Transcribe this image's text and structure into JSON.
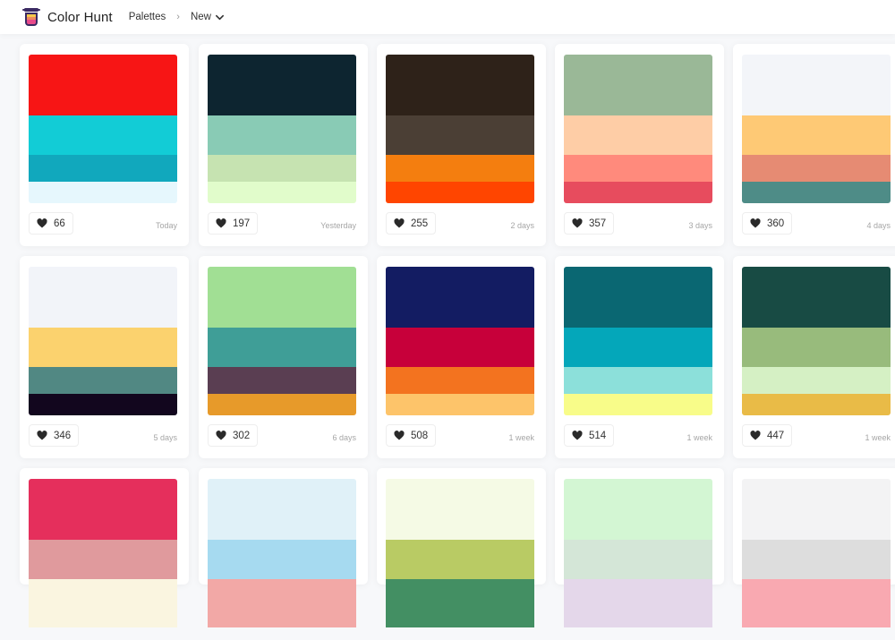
{
  "header": {
    "brand": "Color Hunt",
    "nav_palettes": "Palettes",
    "nav_separator": "›",
    "nav_new": "New",
    "logo_icon": "paint-jar-icon",
    "dropdown_icon": "chevron-down-icon"
  },
  "like_icon": "heart-icon",
  "palettes": [
    {
      "likes": "66",
      "date": "Today",
      "colors": [
        "#f71515",
        "#12ccd6",
        "#11a8bd",
        "#e6f7fd"
      ]
    },
    {
      "likes": "197",
      "date": "Yesterday",
      "colors": [
        "#0d2530",
        "#89cbb5",
        "#c6e3b1",
        "#e1fccb"
      ]
    },
    {
      "likes": "255",
      "date": "2 days",
      "colors": [
        "#2e2219",
        "#4b3f35",
        "#f47e0f",
        "#ff4500"
      ]
    },
    {
      "likes": "357",
      "date": "3 days",
      "colors": [
        "#9ab897",
        "#fecda6",
        "#ff8a7c",
        "#e74c5e"
      ]
    },
    {
      "likes": "360",
      "date": "4 days",
      "colors": [
        "#f3f5f9",
        "#fec975",
        "#e68b73",
        "#4e8c87"
      ]
    },
    {
      "likes": "346",
      "date": "5 days",
      "colors": [
        "#f2f4f9",
        "#fbd26e",
        "#518883",
        "#12061e"
      ]
    },
    {
      "likes": "302",
      "date": "6 days",
      "colors": [
        "#a1df94",
        "#3f9e97",
        "#5a3e52",
        "#e79a2a"
      ]
    },
    {
      "likes": "508",
      "date": "1 week",
      "colors": [
        "#131c62",
        "#c7003a",
        "#f3731f",
        "#fdc46a"
      ]
    },
    {
      "likes": "514",
      "date": "1 week",
      "colors": [
        "#0a6772",
        "#04a7ba",
        "#8ce0da",
        "#f8fc89"
      ]
    },
    {
      "likes": "447",
      "date": "1 week",
      "colors": [
        "#184b44",
        "#98bb7c",
        "#d5f0c4",
        "#e9bb47"
      ]
    },
    {
      "likes": "",
      "date": "",
      "colors": [
        "#e52f5c",
        "#e09a9d",
        "#faf5e0",
        "#faf5e0"
      ]
    },
    {
      "likes": "",
      "date": "",
      "colors": [
        "#e0f1f8",
        "#a6daf0",
        "#f2a8a6",
        "#f2a8a6"
      ]
    },
    {
      "likes": "",
      "date": "",
      "colors": [
        "#f5fae5",
        "#b9cb64",
        "#438f63",
        "#438f63"
      ]
    },
    {
      "likes": "",
      "date": "",
      "colors": [
        "#d3f6d3",
        "#d4e6d7",
        "#e4d7ea",
        "#e4d7ea"
      ]
    },
    {
      "likes": "",
      "date": "",
      "colors": [
        "#f3f3f4",
        "#dddddd",
        "#f9a9b1",
        "#f9a9b1"
      ]
    }
  ]
}
